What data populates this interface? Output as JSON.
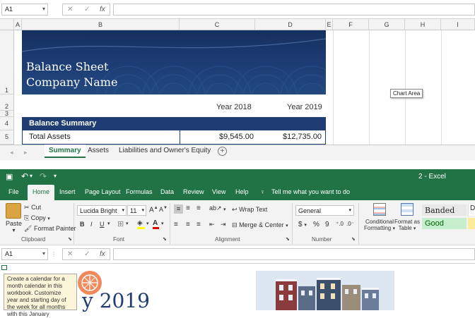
{
  "top_formula_bar": {
    "name_box": "A1",
    "icons": [
      "cancel-icon",
      "enter-icon",
      "fx-icon"
    ],
    "fx_label": "fx"
  },
  "columns": [
    "A",
    "B",
    "C",
    "D",
    "E",
    "F",
    "G",
    "H",
    "I"
  ],
  "rows": [
    "1",
    "2",
    "3",
    "4",
    "5"
  ],
  "banner": {
    "line1": "Balance Sheet",
    "line2": "Company Name"
  },
  "year_headers": [
    "Year 2018",
    "Year 2019"
  ],
  "summary_title": "Balance Summary",
  "asset_row": {
    "label": "Total Assets",
    "v2018": "$9,545.00",
    "v2019": "$12,735.00"
  },
  "chart_area_tip": "Chart Area",
  "sheet_tabs": [
    "Summary",
    "Assets",
    "Liabilities and Owner's Equity"
  ],
  "active_tab": "Summary",
  "add_sheet": "+",
  "window_title": "2  -  Excel",
  "ribbon_tabs": [
    "File",
    "Home",
    "Insert",
    "Page Layout",
    "Formulas",
    "Data",
    "Review",
    "View",
    "Help"
  ],
  "active_ribbon_tab": "Home",
  "tell_me": "Tell me what you want to do",
  "clipboard": {
    "paste": "Paste",
    "cut": "Cut",
    "copy": "Copy",
    "format_painter": "Format Painter",
    "label": "Clipboard"
  },
  "font": {
    "family": "Lucida Bright",
    "size": "11",
    "bold": "B",
    "italic": "I",
    "underline": "U",
    "label": "Font"
  },
  "alignment": {
    "wrap": "Wrap Text",
    "merge": "Merge & Center",
    "label": "Alignment"
  },
  "number": {
    "format": "General",
    "currency": "$",
    "percent": "%",
    "comma": "9",
    "label": "Number"
  },
  "styles": {
    "conditional": "Conditional",
    "formatting": "Formatting",
    "format_as": "Format as",
    "table": "Table",
    "banded": "Banded",
    "good": "Good"
  },
  "second_formula_bar": {
    "name_box": "A1"
  },
  "tooltip_text": "Create a calendar for a month calendar in this workbook. Customize year and starting day of the week for all months with this January",
  "calendar_year": "y 2019",
  "colors": {
    "excel_green": "#217346",
    "banner_blue": "#1b3a70",
    "summary_blue": "#1f3d73"
  }
}
